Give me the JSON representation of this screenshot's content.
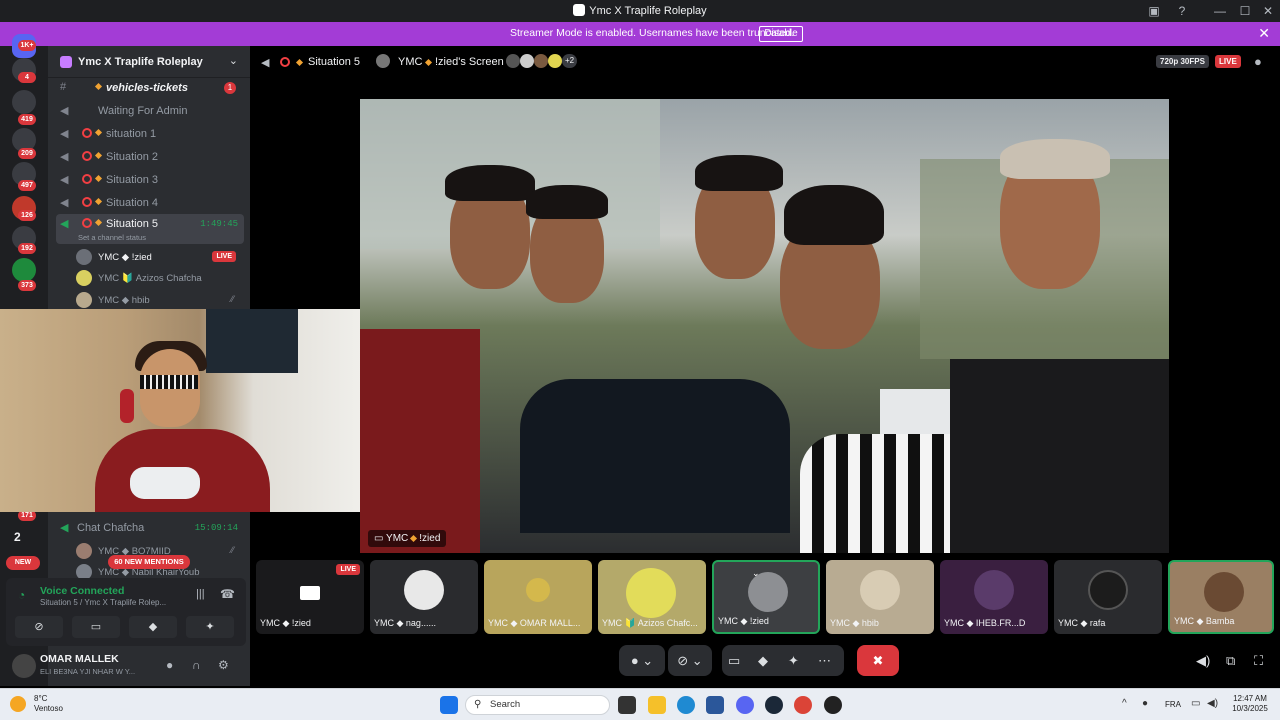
{
  "window": {
    "title": "Ymc X Traplife Roleplay"
  },
  "banner": {
    "message": "Streamer Mode is enabled. Usernames have been truncated.",
    "disable_label": "Disable"
  },
  "rail": {
    "badges": [
      "1K+",
      "4",
      "419",
      "209",
      "497",
      "126",
      "192",
      "373",
      "171"
    ]
  },
  "sidebar": {
    "server_name": "Ymc X Traplife Roleplay",
    "channels": [
      {
        "label": "vehicles-tickets",
        "badge": "1"
      },
      {
        "label": "Waiting For Admin"
      },
      {
        "label": "situation 1"
      },
      {
        "label": "Situation 2"
      },
      {
        "label": "Situation 3"
      },
      {
        "label": "Situation 4"
      },
      {
        "label": "Situation 5",
        "time": "1:49:45"
      }
    ],
    "channel_status": "Set a channel status",
    "members": [
      {
        "label": "YMC ◆ !zied",
        "live": "LIVE"
      },
      {
        "label": "YMC 🔰 Azizos Chafcha"
      },
      {
        "label": "YMC ◆ hbib"
      }
    ],
    "chat_channel": {
      "label": "Chat Chafcha",
      "time": "15:09:14"
    },
    "chat_members": [
      {
        "label": "YMC ◆ BO7MIID"
      },
      {
        "label": "YMC ◆ Nabil KhairYoub"
      }
    ],
    "server_count": "2",
    "new_label": "NEW",
    "mentions": "60 NEW MENTIONS"
  },
  "voice": {
    "status": "Voice Connected",
    "location": "Situation 5 / Ymc X Traplife Rolep..."
  },
  "user": {
    "name": "OMAR MALLEK",
    "status": "ELI BE3NA YJI NHAR W Y..."
  },
  "stage": {
    "channel": "Situation 5",
    "screen_owner": "YMC",
    "screen_name": "!zied's Screen",
    "extra_count": "+2",
    "quality": "720p 30FPS",
    "live": "LIVE"
  },
  "video": {
    "tag_prefix": "YMC",
    "tag_name": "!zied"
  },
  "tiles": [
    {
      "label": "YMC ◆ !zied",
      "live": "LIVE"
    },
    {
      "label": "YMC ◆ nag......"
    },
    {
      "label": "YMC ◆ OMAR MALL..."
    },
    {
      "label": "YMC 🔰 Azizos Chafc..."
    },
    {
      "label": "YMC ◆ !zied"
    },
    {
      "label": "YMC ◆ hbib"
    },
    {
      "label": "YMC ◆ IHEB.FR...D"
    },
    {
      "label": "YMC ◆ rafa"
    },
    {
      "label": "YMC ◆ Bamba"
    }
  ],
  "taskbar": {
    "weather_temp": "8°C",
    "weather_desc": "Ventoso",
    "search_placeholder": "Search",
    "lang": "FRA",
    "time": "12:47 AM",
    "date": "10/3/2025"
  }
}
